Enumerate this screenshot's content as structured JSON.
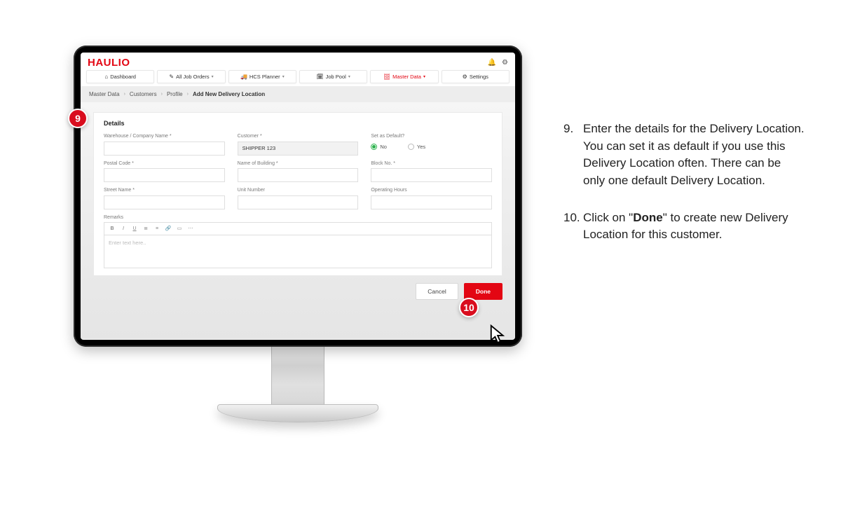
{
  "logo": "HAULIO",
  "nav": {
    "dashboard": "Dashboard",
    "job_orders": "All Job Orders",
    "hcs_planner": "HCS Planner",
    "job_pool": "Job Pool",
    "master_data": "Master Data",
    "settings": "Settings"
  },
  "breadcrumb": {
    "a": "Master Data",
    "b": "Customers",
    "c": "Profile",
    "d": "Add New Delivery Location"
  },
  "card": {
    "title": "Details",
    "labels": {
      "warehouse": "Warehouse / Company Name *",
      "customer": "Customer *",
      "set_default": "Set as Default?",
      "postal": "Postal Code *",
      "building": "Name of Building *",
      "block": "Block No. *",
      "street": "Street Name *",
      "unit": "Unit Number",
      "hours": "Operating Hours",
      "remarks": "Remarks"
    },
    "customer_value": "SHIPPER 123",
    "radio_no": "No",
    "radio_yes": "Yes",
    "editor_placeholder": "Enter text here.."
  },
  "buttons": {
    "cancel": "Cancel",
    "done": "Done"
  },
  "callouts": {
    "nine": "9",
    "ten": "10"
  },
  "instructions": {
    "nine_num": "9.",
    "nine_text": "Enter the details for the Delivery Location. You can set it as default if you use this Delivery Location often. There can be only one default Delivery Location.",
    "ten_num": "10.",
    "ten_pre": "Click on \"",
    "ten_bold": "Done",
    "ten_post": "\" to create new Delivery Location for this customer."
  }
}
